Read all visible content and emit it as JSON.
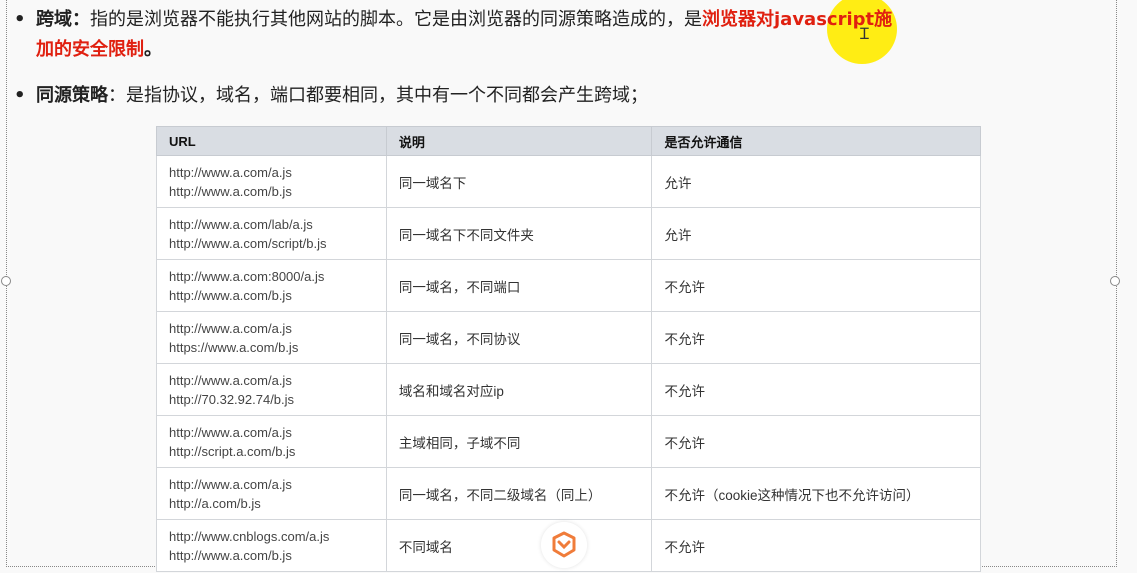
{
  "bullets": [
    {
      "term": "跨域",
      "colon": "：",
      "text": "指的是浏览器不能执行其他网站的脚本。它是由浏览器的同源策略造成的，是",
      "red_text_1": "浏览器对javascript施",
      "red_text_2": "加的安全限制",
      "end": "。"
    },
    {
      "term": "同源策略",
      "text": "：是指协议，域名，端口都要相同，其中有一个不同都会产生跨域；"
    }
  ],
  "table": {
    "headers": [
      "URL",
      "说明",
      "是否允许通信"
    ],
    "rows": [
      {
        "url1": "http://www.a.com/a.js",
        "url2": "http://www.a.com/b.js",
        "desc": "同一域名下",
        "allowed": "允许"
      },
      {
        "url1": "http://www.a.com/lab/a.js",
        "url2": "http://www.a.com/script/b.js",
        "desc": "同一域名下不同文件夹",
        "allowed": "允许"
      },
      {
        "url1": "http://www.a.com:8000/a.js",
        "url2": "http://www.a.com/b.js",
        "desc": "同一域名，不同端口",
        "allowed": "不允许"
      },
      {
        "url1": "http://www.a.com/a.js",
        "url2": "https://www.a.com/b.js",
        "desc": "同一域名，不同协议",
        "allowed": "不允许"
      },
      {
        "url1": "http://www.a.com/a.js",
        "url2": "http://70.32.92.74/b.js",
        "desc": "域名和域名对应ip",
        "allowed": "不允许"
      },
      {
        "url1": "http://www.a.com/a.js",
        "url2": "http://script.a.com/b.js",
        "desc": "主域相同，子域不同",
        "allowed": "不允许"
      },
      {
        "url1": "http://www.a.com/a.js",
        "url2": "http://a.com/b.js",
        "desc": "同一域名，不同二级域名（同上）",
        "allowed": "不允许（cookie这种情况下也不允许访问）"
      },
      {
        "url1": "http://www.cnblogs.com/a.js",
        "url2": "http://www.a.com/b.js",
        "desc": "不同域名",
        "allowed": "不允许"
      }
    ]
  },
  "colors": {
    "accent_red": "#e02010",
    "highlight": "#ffec00",
    "header_bg": "#d9dde3"
  },
  "icons": {
    "cursor": "text-cursor-icon",
    "logo": "watermark-logo-icon"
  }
}
